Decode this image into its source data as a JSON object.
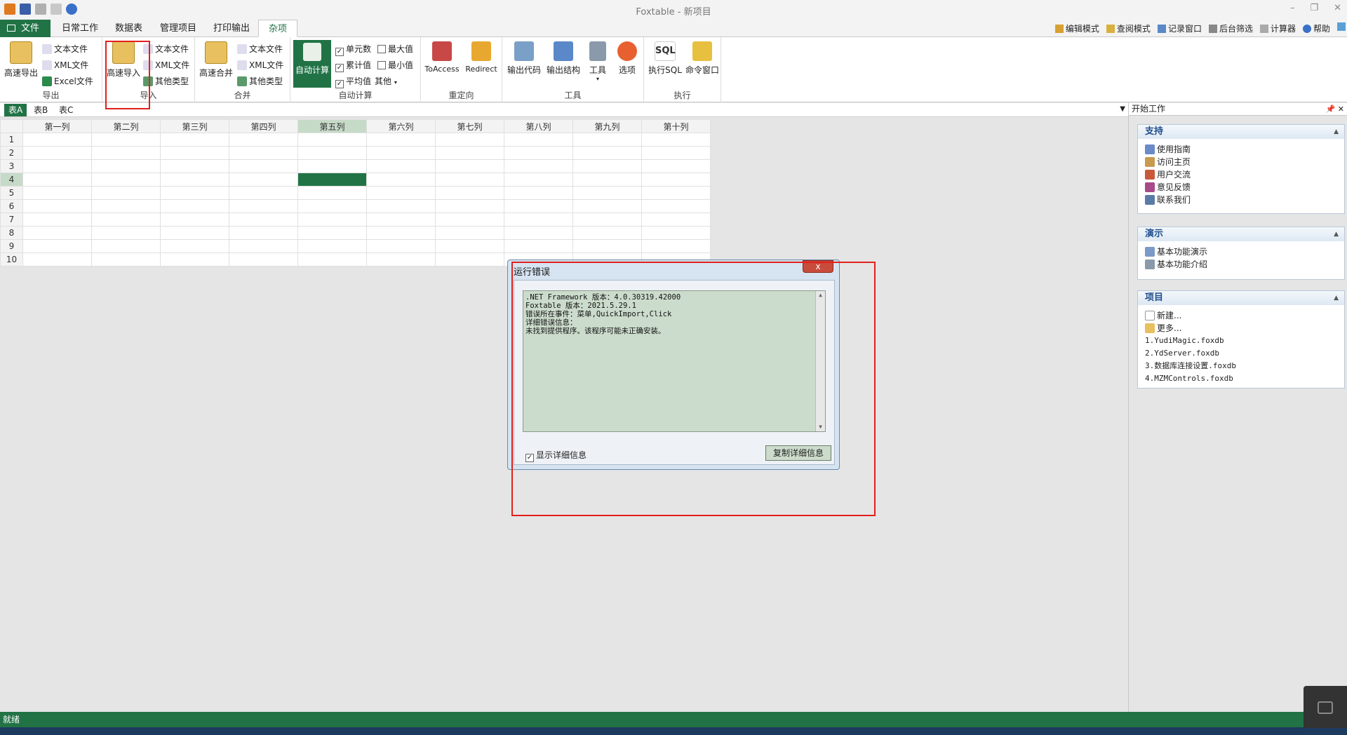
{
  "window": {
    "title": "Foxtable - 新项目"
  },
  "ribbon_tabs": [
    "文件",
    "日常工作",
    "数据表",
    "管理项目",
    "打印输出",
    "杂项"
  ],
  "right_tools": [
    "编辑模式",
    "查阅模式",
    "记录窗口",
    "后台筛选",
    "计算器",
    "帮助"
  ],
  "ribbon": {
    "export": {
      "big": "高速导出",
      "items": [
        "文本文件",
        "XML文件",
        "Excel文件"
      ],
      "label": "导出"
    },
    "import": {
      "big": "高速导入",
      "items": [
        "文本文件",
        "XML文件",
        "其他类型"
      ],
      "label": "导入"
    },
    "merge": {
      "big": "高速合并",
      "items": [
        "文本文件",
        "XML文件",
        "其他类型"
      ],
      "label": "合并"
    },
    "autocalc": {
      "big": "自动计算",
      "checks": [
        "单元数",
        "累计值",
        "平均值"
      ],
      "checks2": [
        "最大值",
        "最小值"
      ],
      "other": "其他",
      "label": "自动计算"
    },
    "redirect": {
      "items": [
        "ToAccess",
        "Redirect"
      ],
      "label": "重定向"
    },
    "tools": {
      "items": [
        "输出代码",
        "输出结构",
        "工具",
        "选项"
      ],
      "label": "工具"
    },
    "exec": {
      "items": [
        "执行SQL",
        "命令窗口"
      ],
      "label": "执行"
    }
  },
  "sheets": [
    "表A",
    "表B",
    "表C"
  ],
  "grid": {
    "columns": [
      "第一列",
      "第二列",
      "第三列",
      "第四列",
      "第五列",
      "第六列",
      "第七列",
      "第八列",
      "第九列",
      "第十列"
    ],
    "rows": [
      "1",
      "2",
      "3",
      "4",
      "5",
      "6",
      "7",
      "8",
      "9",
      "10"
    ]
  },
  "panel": {
    "title": "开始工作",
    "support": {
      "title": "支持",
      "items": [
        "使用指南",
        "访问主页",
        "用户交流",
        "意见反馈",
        "联系我们"
      ]
    },
    "demo": {
      "title": "演示",
      "items": [
        "基本功能演示",
        "基本功能介绍"
      ]
    },
    "project": {
      "title": "项目",
      "items": [
        "新建...",
        "更多..."
      ],
      "recent": [
        "1.YudiMagic.foxdb",
        "2.YdServer.foxdb",
        "3.数据库连接设置.foxdb",
        "4.MZMControls.foxdb"
      ]
    }
  },
  "dialog": {
    "title": "运行错误",
    "close": "x",
    "lines": [
      ".NET Framework 版本：4.0.30319.42000",
      "Foxtable 版本：2021.5.29.1",
      "错误所在事件：菜单,QuickImport,Click",
      "详细错误信息：",
      "未找到提供程序。该程序可能未正确安装。"
    ],
    "checkbox": "显示详细信息",
    "copy_button": "复制详细信息"
  },
  "status": "就绪",
  "colors": {
    "accent": "#217346",
    "annotation": "#e0201c"
  }
}
